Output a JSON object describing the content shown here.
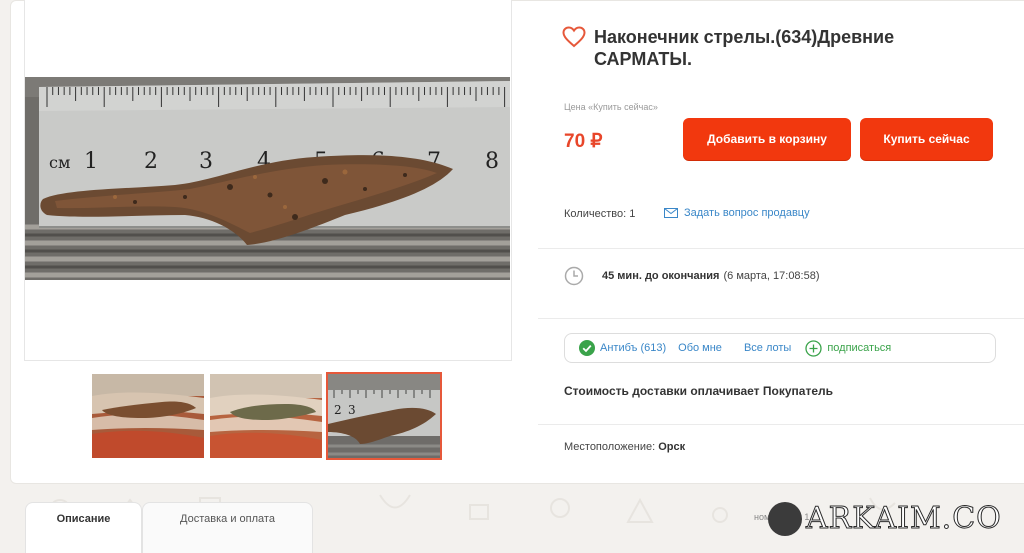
{
  "lot": {
    "title": "Наконечник стрелы.(634)Древние САРМАТЫ.",
    "price_label": "Цена «Купить сейчас»",
    "price": "70 ₽",
    "add_to_cart": "Добавить в корзину",
    "buy_now": "Купить сейчас",
    "quantity_label": "Количество:",
    "quantity_value": "1",
    "ask_seller": "Задать вопрос продавцу",
    "time_left": "45 мин. до окончания",
    "end_date": "(6 марта, 17:08:58)",
    "shipping_note": "Стоимость доставки оплачивает Покупатель",
    "location_label": "Местоположение:",
    "location_value": "Орск"
  },
  "seller": {
    "name_rating": "Антибъ (613)",
    "about": "Обо мне",
    "all_lots": "Все лоты",
    "subscribe": "подписаться"
  },
  "ruler": {
    "unit": "см",
    "numbers": [
      "1",
      "2",
      "3",
      "4",
      "5",
      "6",
      "7",
      "8"
    ]
  },
  "thumbs": {
    "ruler_numbers": [
      "2",
      "3"
    ]
  },
  "tabs": {
    "description": "Описание",
    "delivery": "Доставка и оплата"
  },
  "footer": {
    "lot_number": "номер лота 1",
    "watermark": "ARKAIM.CO"
  },
  "colors": {
    "accent": "#f2380e",
    "price": "#e8462a",
    "link": "#3a87c8",
    "verified": "#3aa34a"
  },
  "icons": {
    "favorite": "heart-icon",
    "message": "envelope-icon",
    "timer": "clock-icon",
    "verified": "check-circle-icon",
    "subscribe": "plus-circle-icon"
  }
}
